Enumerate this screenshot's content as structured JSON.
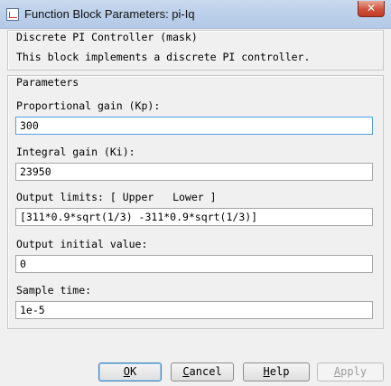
{
  "window": {
    "title": "Function Block Parameters: pi-Iq",
    "close_glyph": "✕"
  },
  "mask": {
    "legend": "Discrete PI Controller (mask)",
    "description": "This block implements a discrete PI controller."
  },
  "parameters": {
    "legend": "Parameters",
    "fields": [
      {
        "label": "Proportional gain (Kp):",
        "value": "300"
      },
      {
        "label": "Integral gain (Ki):",
        "value": "23950"
      },
      {
        "label": "Output limits: [ Upper   Lower ]",
        "value": "[311*0.9*sqrt(1/3) -311*0.9*sqrt(1/3)]"
      },
      {
        "label": "Output initial value:",
        "value": "0"
      },
      {
        "label": "Sample time:",
        "value": "1e-5"
      }
    ]
  },
  "buttons": {
    "ok": {
      "mnemonic": "O",
      "rest": "K"
    },
    "cancel": {
      "mnemonic": "C",
      "rest": "ancel"
    },
    "help": {
      "mnemonic": "H",
      "rest": "elp"
    },
    "apply": {
      "mnemonic": "A",
      "rest": "pply"
    }
  }
}
